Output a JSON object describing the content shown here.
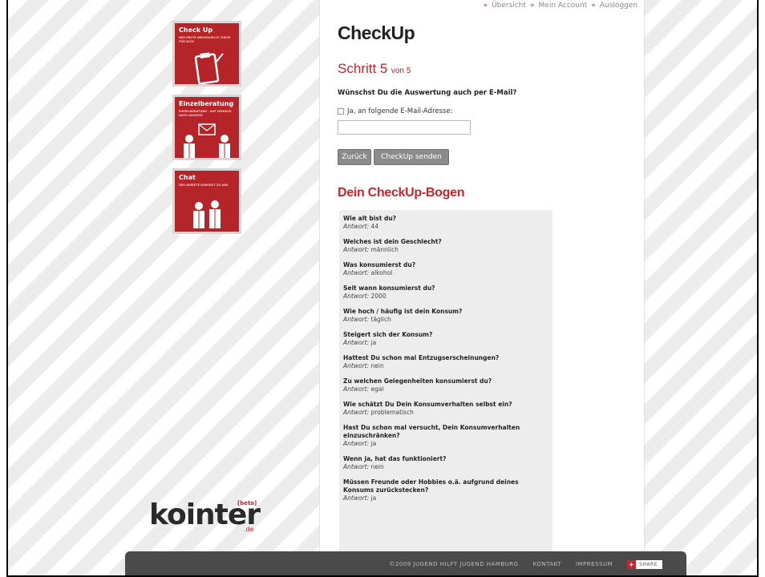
{
  "topnav": {
    "items": [
      "Übersicht",
      "Mein Account",
      "Ausloggen"
    ],
    "sep": "»"
  },
  "page": {
    "title": "CheckUp"
  },
  "step": {
    "label": "Schritt 5",
    "of": "von 5"
  },
  "email_question": {
    "question": "Wünschst Du die Auswertung auch per E-Mail?",
    "checkbox_label": "Ja, an folgende E-Mail-Adresse:",
    "email_value": ""
  },
  "buttons": {
    "back": "Zurück",
    "send": "CheckUp senden"
  },
  "section": {
    "title": "Dein CheckUp-Bogen"
  },
  "answer_prefix": "Antwort:",
  "qa": [
    {
      "q": "Wie alt bist du?",
      "a": "44"
    },
    {
      "q": "Welches ist dein Geschlecht?",
      "a": "männlich"
    },
    {
      "q": "Was konsumierst du?",
      "a": "alkohol"
    },
    {
      "q": "Seit wann konsumierst du?",
      "a": "2000"
    },
    {
      "q": "Wie hoch / häufig ist dein Konsum?",
      "a": "täglich"
    },
    {
      "q": "Steigert sich der Konsum?",
      "a": "ja"
    },
    {
      "q": "Hattest Du schon mal Entzugserscheinungen?",
      "a": "nein"
    },
    {
      "q": "Zu welchen Gelegenheiten konsumierst du?",
      "a": "egal"
    },
    {
      "q": "Wie schätzt Du Dein Konsumverhalten selbst ein?",
      "a": "problematisch"
    },
    {
      "q": "Hast Du schon mal versucht, Dein Konsumverhalten einzuschränken?",
      "a": "ja"
    },
    {
      "q": "Wenn ja, hat das funktioniert?",
      "a": "nein"
    },
    {
      "q": "Müssen Freunde oder Hobbies o.ä. aufgrund deines Konsums zurückstecken?",
      "a": "ja"
    }
  ],
  "sidebar": {
    "tiles": [
      {
        "title": "Check Up",
        "sub": "DER ERSTE INDIVIDUELLE CHECK FÜR DICH",
        "icon": "clipboard-icon"
      },
      {
        "title": "Einzelberatung",
        "sub": "EINZELBERATUNG - AUF WUNSCH AUCH ANONYM",
        "icon": "consultation-icon"
      },
      {
        "title": "Chat",
        "sub": "DER DIREKTE KONTAKT ZU UNS",
        "icon": "chat-people-icon"
      }
    ]
  },
  "logo": {
    "text": "kointer",
    "beta": "[beta]",
    "domain": ".de"
  },
  "footer": {
    "copyright": "©2009 JUGEND HILFT JUGEND HAMBURG",
    "contact": "KONTAKT",
    "imprint": "IMPRESSUM",
    "share": "SHARE"
  },
  "colors": {
    "accent": "#c3262b",
    "button": "#8b8b8b",
    "footer": "#4a4a4a"
  }
}
